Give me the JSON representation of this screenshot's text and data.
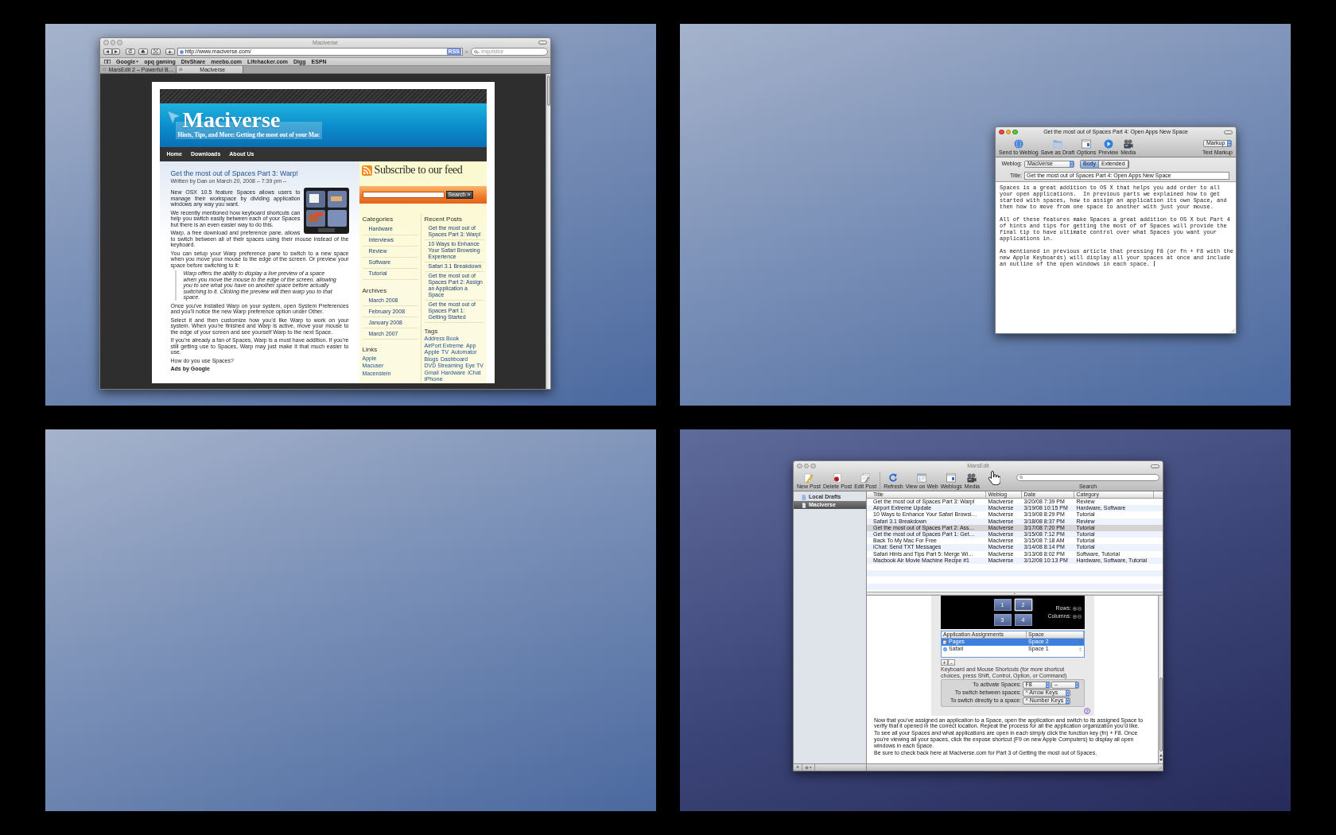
{
  "spaces": [
    {
      "kind": "browser",
      "highlighted": false,
      "window": {
        "title": "Maciverse",
        "active": false,
        "address": "http://www.maciverse.com/",
        "rss_badge": "RSS",
        "search": {
          "placeholder": "Inquisitor"
        },
        "bookmarks": [
          {
            "label": "Google",
            "menu": true
          },
          {
            "label": "opq gaming",
            "menu": false
          },
          {
            "label": "DivShare",
            "menu": false
          },
          {
            "label": "meebo.com",
            "menu": false
          },
          {
            "label": "Lifehacker.com",
            "menu": false
          },
          {
            "label": "Digg",
            "menu": false
          },
          {
            "label": "ESPN",
            "menu": false
          }
        ],
        "tabs": [
          {
            "label": "MarsEdit 2 – Powerful B…",
            "selected": false
          },
          {
            "label": "Maciverse",
            "selected": true
          }
        ],
        "page": {
          "site_title": "Maciverse",
          "tagline": "Hints, Tips, and More: Getting the most out of your Mac",
          "nav": [
            "Home",
            "Downloads",
            "About Us"
          ],
          "post": {
            "title": "Get the most out of Spaces Part 3: Warp!",
            "byline": "Written by Dan on March 20, 2008 – 7:39 pm –",
            "blocks": [
              {
                "kind": "paragraph",
                "text": "New OSX 10.5 feature Spaces allows users to manage their workspace by dividing application windows any way you want."
              },
              {
                "kind": "paragraph",
                "text": "We recently mentioned how keyboard shortcuts can help you switch easily between each of your Spaces but there is an even easier way to do this."
              },
              {
                "kind": "paragraph",
                "text": "Warp, a free download and preference pane, allows to switch between all of their spaces using their mouse instead of the keyboard."
              },
              {
                "kind": "paragraph",
                "text": "You can setup your Warp preference pane to switch to a new space when you move your mouse to the edge of the screen. Or preview your space before switching to it:"
              },
              {
                "kind": "quote",
                "text": "Warp offers the ability to display a live preview of a space when you move the mouse to the edge of the screen, allowing you to see what you have on another space before actually switching to it. Clicking the preview will then warp you to that space."
              },
              {
                "kind": "paragraph",
                "text": "Once you’ve installed Warp on your system, open System Preferences and you’ll notice the new Warp preference option under Other."
              },
              {
                "kind": "paragraph",
                "text": "Select it and then customize how you’d like Warp to work on your system. When you’re finished and Warp is active, move your mouse to the edge of your screen and see yourself Warp to the next Space."
              },
              {
                "kind": "paragraph",
                "text": "If you’re already a fan of Spaces, Warp is a must have addition. If you’re still getting use to Spaces, Warp may just make it that much easier to use."
              },
              {
                "kind": "paragraph",
                "text": "How do you use Spaces?"
              }
            ],
            "ads_label": "Ads by Google"
          },
          "sidebar": {
            "feed": "Subscribe to our feed",
            "search_button": "Search »",
            "categories": {
              "heading": "Categories",
              "items": [
                "Hardware",
                "Interviews",
                "Review",
                "Software",
                "Tutorial"
              ]
            },
            "archives": {
              "heading": "Archives",
              "items": [
                "March 2008",
                "February 2008",
                "January 2008",
                "March 2007"
              ]
            },
            "links": {
              "heading": "Links",
              "items": [
                "Apple",
                "Macuser",
                "Macenstein"
              ]
            },
            "recent_posts": {
              "heading": "Recent Posts",
              "items": [
                "Get the most out of Spaces Part 3: Warp!",
                "10 Ways to Enhance Your Safari Browsing Experience",
                "Safari 3.1 Breakdown",
                "Get the most out of Spaces Part 2: Assign an Application a Space",
                "Get the most out of Spaces Part 1: Getting Started"
              ]
            },
            "tags": {
              "heading": "Tags",
              "items": [
                {
                  "label": "Address Book",
                  "large": false
                },
                {
                  "label": "AirPort Extreme",
                  "large": false
                },
                {
                  "label": "App",
                  "large": false
                },
                {
                  "label": "Apple TV",
                  "large": true
                },
                {
                  "label": "Automator",
                  "large": false
                },
                {
                  "label": "Blogs",
                  "large": false
                },
                {
                  "label": "Dashboard",
                  "large": false
                },
                {
                  "label": "DVD Streaming",
                  "large": false
                },
                {
                  "label": "Eye TV",
                  "large": false
                },
                {
                  "label": "Gmail",
                  "large": false
                },
                {
                  "label": "Hardware",
                  "large": false
                },
                {
                  "label": "iChat",
                  "large": false
                },
                {
                  "label": "iPhone",
                  "large": true
                }
              ]
            }
          }
        }
      }
    },
    {
      "kind": "editor",
      "highlighted": false,
      "window": {
        "title": "Get the most out of Spaces Part 4: Open Apps New Space",
        "active": true,
        "toolbar": [
          {
            "kind": "send",
            "label": "Send to Weblog"
          },
          {
            "kind": "draft",
            "label": "Save as Draft"
          },
          {
            "kind": "options",
            "label": "Options"
          },
          {
            "kind": "preview",
            "label": "Preview"
          },
          {
            "kind": "media",
            "label": "Media"
          }
        ],
        "markup": {
          "value": "Markup",
          "label": "Text Markup"
        },
        "weblog": {
          "label": "Weblog:",
          "value": "Maciverse"
        },
        "modes": [
          {
            "label": "Body",
            "selected": true
          },
          {
            "label": "Extended",
            "selected": false
          }
        ],
        "post_title": {
          "label": "Title:",
          "value": "Get the most out of Spaces Part 4: Open Apps New Space"
        },
        "body": [
          "Spaces is a great addition to OS X that helps you add order to all your open applications.  In previous parts we explained how to get started with spaces, how to assign an application its own Space, and then how to move from one space to another with just your mouse.",
          "All of these features make Spaces a great addition to OS X but Part 4 of hints and tips for getting the most of of Spaces will provide the final tip to have ultimate control over what Spaces you want your applications in.",
          "As mentioned in previous article that pressing F8 (or fn + F8 with the new Apple Keyboards) will display all your spaces at once and include an outline of the open windows in each space."
        ]
      }
    },
    {
      "kind": "empty",
      "highlighted": false
    },
    {
      "kind": "blog_manager",
      "highlighted": true,
      "window": {
        "title": "MarsEdit",
        "active": false,
        "toolbar_groups": [
          {
            "items": [
              {
                "kind": "new_post",
                "label": "New Post"
              },
              {
                "kind": "delete_post",
                "label": "Delete Post"
              },
              {
                "kind": "edit_post",
                "label": "Edit Post"
              }
            ]
          },
          {
            "items": [
              {
                "kind": "refresh",
                "label": "Refresh"
              },
              {
                "kind": "view_web",
                "label": "View on Web"
              },
              {
                "kind": "weblogs",
                "label": "Weblogs"
              },
              {
                "kind": "media",
                "label": "Media"
              }
            ]
          }
        ],
        "search_label": "Search",
        "sources": [
          {
            "kind": "drafts",
            "label": "Local Drafts",
            "selected": false
          },
          {
            "kind": "weblog",
            "label": "Maciverse",
            "selected": true
          }
        ],
        "columns": [
          "Title",
          "Weblog",
          "Date",
          "Category"
        ],
        "posts": [
          {
            "title": "Get the most out of Spaces Part 3: Warp!",
            "weblog": "Maciverse",
            "date": "3/20/08 7:39 PM",
            "category": "Review",
            "selected": false
          },
          {
            "title": "Airport Extreme Update",
            "weblog": "Maciverse",
            "date": "3/19/08 10:15 PM",
            "category": "Hardware, Software",
            "selected": false
          },
          {
            "title": "10 Ways to Enhance Your Safari Browsi…",
            "weblog": "Maciverse",
            "date": "3/19/08 8:29 PM",
            "category": "Tutorial",
            "selected": false
          },
          {
            "title": "Safari 3.1 Breakdown",
            "weblog": "Maciverse",
            "date": "3/18/08 8:37 PM",
            "category": "Review",
            "selected": false
          },
          {
            "title": "Get the most out of Spaces Part 2: Ass…",
            "weblog": "Maciverse",
            "date": "3/17/08 7:20 PM",
            "category": "Tutorial",
            "selected": true
          },
          {
            "title": "Get the most out of Spaces Part 1: Get…",
            "weblog": "Maciverse",
            "date": "3/15/08 7:12 PM",
            "category": "Tutorial",
            "selected": false
          },
          {
            "title": "Back To My Mac For Free",
            "weblog": "Maciverse",
            "date": "3/15/08 7:18 AM",
            "category": "Tutorial",
            "selected": false
          },
          {
            "title": "iChat: Send TXT Messages",
            "weblog": "Maciverse",
            "date": "3/14/08 8:14 PM",
            "category": "Tutorial",
            "selected": false
          },
          {
            "title": "Safari Hints and Tips Part 5: Merge Wi…",
            "weblog": "Maciverse",
            "date": "3/13/08 8:02 PM",
            "category": "Software, Tutorial",
            "selected": false
          },
          {
            "title": "Macbook Air Movie Machine Recipe #1",
            "weblog": "Maciverse",
            "date": "3/12/08 10:13 PM",
            "category": "Hardware, Software, Tutorial",
            "selected": false
          }
        ],
        "preview": {
          "figure": {
            "spaces": [
              {
                "label": "1",
                "selected": false
              },
              {
                "label": "2",
                "selected": true
              },
              {
                "label": "3",
                "selected": false
              },
              {
                "label": "4",
                "selected": false
              }
            ],
            "rows_label": "Rows:",
            "columns_label": "Columns:",
            "assignments": {
              "columns": [
                "Application Assignments",
                "Space"
              ],
              "rows": [
                {
                  "kind": "pen",
                  "app": "Pages",
                  "space": "Space 2",
                  "selected": true
                },
                {
                  "kind": "compass",
                  "app": "Safari",
                  "space": "Space 1",
                  "selected": false
                }
              ]
            },
            "add": "+",
            "remove": "-",
            "caption": "Keyboard and Mouse Shortcuts (for more shortcut choices, press Shift, Control, Option, or Command)",
            "shortcuts": [
              {
                "label": "To activate Spaces:",
                "values": [
                  "F8",
                  "–"
                ]
              },
              {
                "label": "To switch between spaces:",
                "values": [
                  "^ Arrow Keys"
                ]
              },
              {
                "label": "To switch directly to a space:",
                "values": [
                  "^ Number Keys"
                ]
              }
            ],
            "help": "?"
          },
          "paragraphs": [
            "Now that you’ve assigned an application to a Space, open the application and switch to its assigned Space to verify that it opened in the correct location. Repeat the process for all the application organization you’d like.",
            "To see all your Spaces and what applications are open in each simply click the function key (fn) + F8. Once you’re viewing all your spaces, click the expose shortcut (F9 on new Apple Computers) to display all open windows in each Space.",
            "Be sure to check back here at Maciverse.com for Part 3 of Getting the most out of Spaces."
          ]
        },
        "bottom": {
          "add_button": "+"
        }
      }
    }
  ]
}
